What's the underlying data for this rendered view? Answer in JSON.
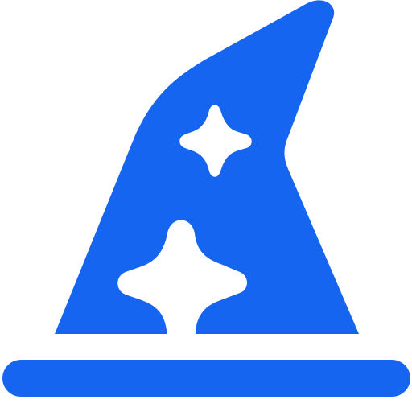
{
  "icon": {
    "name": "wizard-hat-icon",
    "color": "#1565f0",
    "background": "#ffffff"
  }
}
